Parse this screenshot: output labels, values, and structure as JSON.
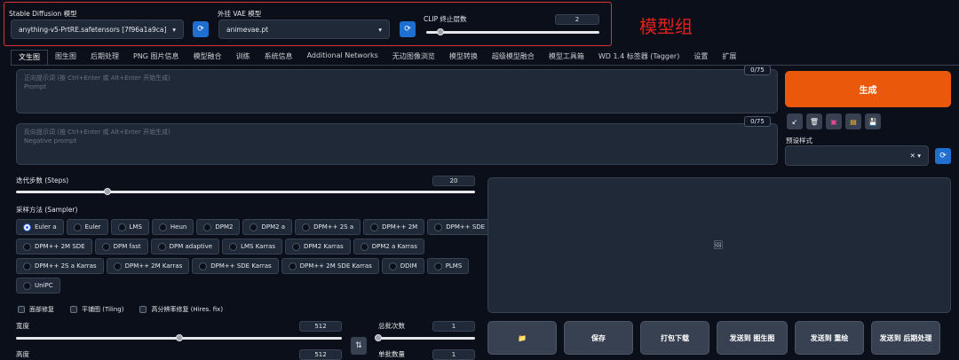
{
  "models": {
    "sd_label": "Stable Diffusion 模型",
    "sd_value": "anything-v5-PrtRE.safetensors [7f96a1a9ca]",
    "vae_label": "外挂 VAE 模型",
    "vae_value": "animevae.pt",
    "clip_label": "CLIP 终止层数",
    "clip_value": "2",
    "clip_fraction": 0.08,
    "annotation": "模型组",
    "annotation_color": "#e0201c"
  },
  "tabs": [
    "文生图",
    "图生图",
    "后期处理",
    "PNG 图片信息",
    "模型融合",
    "训练",
    "系统信息",
    "Additional Networks",
    "无边图像浏览",
    "模型转换",
    "超级模型融合",
    "模型工具箱",
    "WD 1.4 标签器 (Tagger)",
    "设置",
    "扩展"
  ],
  "prompt": {
    "placeholder1": "正向提示词 (按 Ctrl+Enter 或 Alt+Enter 开始生成)",
    "placeholder2": "Prompt",
    "counter": "0/75"
  },
  "negative": {
    "placeholder1": "反向提示词 (按 Ctrl+Enter 或 Alt+Enter 开始生成)",
    "placeholder2": "Negative prompt",
    "counter": "0/75"
  },
  "generate": {
    "label": "生成",
    "color": "#ea580c"
  },
  "tools": {
    "icons": [
      "arrow-icon",
      "trash-icon",
      "image-icon",
      "clipboard-icon",
      "save-icon"
    ],
    "glyphs": [
      "↙",
      "🗑",
      "▣",
      "▤",
      "💾"
    ]
  },
  "styles": {
    "label": "预设样式",
    "clear": "✕ ▾"
  },
  "steps": {
    "label": "迭代步数 (Steps)",
    "value": "20",
    "fraction": 0.2
  },
  "sampler": {
    "label": "采样方法 (Sampler)",
    "rows": [
      [
        "Euler a",
        "Euler",
        "LMS",
        "Heun",
        "DPM2",
        "DPM2 a",
        "DPM++ 2S a",
        "DPM++ 2M",
        "DPM++ SDE"
      ],
      [
        "DPM++ 2M SDE",
        "DPM fast",
        "DPM adaptive",
        "LMS Karras",
        "DPM2 Karras",
        "DPM2 a Karras"
      ],
      [
        "DPM++ 2S a Karras",
        "DPM++ 2M Karras",
        "DPM++ SDE Karras",
        "DPM++ 2M SDE Karras",
        "DDIM",
        "PLMS"
      ],
      [
        "UniPC"
      ]
    ],
    "selected": "Euler a"
  },
  "checks": [
    "面部修复",
    "平铺图 (Tiling)",
    "高分辨率修复 (Hires. fix)"
  ],
  "width": {
    "label": "宽度",
    "value": "512",
    "fraction": 0.5
  },
  "height": {
    "label": "高度",
    "value": "512"
  },
  "swap": "⇅",
  "batch_count": {
    "label": "总批次数",
    "value": "1",
    "fraction": 0.0
  },
  "batch_size": {
    "label": "单批数量",
    "value": "1"
  },
  "actions": [
    "📁",
    "保存",
    "打包下载",
    "发送到 图生图",
    "发送到 重绘",
    "发送到 后期处理"
  ],
  "image_placeholder": "🖼"
}
